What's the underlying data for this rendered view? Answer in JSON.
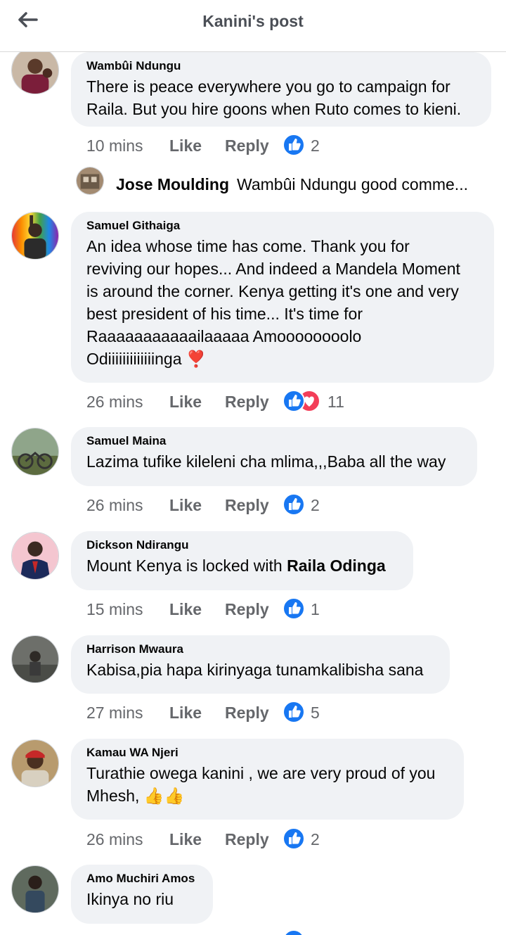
{
  "header": {
    "title": "Kanini's post"
  },
  "colors": {
    "like_blue": "#1877f2",
    "love_red": "#f33e58",
    "bubble_bg": "#f0f2f5",
    "meta_gray": "#65676b"
  },
  "labels": {
    "like": "Like",
    "reply": "Reply"
  },
  "comments": [
    {
      "author": "Wambûi Ndungu",
      "lines": [
        "There is peace everywhere you go to campaign for",
        "Raila. But you hire goons when Ruto comes to kieni."
      ],
      "time": "10 mins",
      "reactions": [
        "like-icon"
      ],
      "count": "2"
    },
    {
      "author": "Samuel Githaiga",
      "lines": [
        "An idea whose time has come. Thank you for",
        "reviving our hopes... And indeed a Mandela Moment",
        "is around the corner. Kenya getting it's one and very",
        "best president of his time... It's time for",
        "Raaaaaaaaaaailaaaaa Amoooooooolo",
        "Odiiiiiiiiiiiiinga ❣️"
      ],
      "time": "26 mins",
      "reactions": [
        "like-icon",
        "love-icon"
      ],
      "count": "11"
    },
    {
      "author": "Samuel Maina",
      "lines": [
        "Lazima tufike kileleni cha mlima,,,Baba all the way"
      ],
      "time": "26 mins",
      "reactions": [
        "like-icon"
      ],
      "count": "2"
    },
    {
      "author": "Dickson Ndirangu",
      "text_prefix": "Mount Kenya is locked with ",
      "text_mention": "Raila Odinga",
      "time": "15 mins",
      "reactions": [
        "like-icon"
      ],
      "count": "1"
    },
    {
      "author": "Harrison Mwaura",
      "lines": [
        "Kabisa,pia hapa kirinyaga tunamkalibisha sana"
      ],
      "time": "27 mins",
      "reactions": [
        "like-icon"
      ],
      "count": "5"
    },
    {
      "author": "Kamau WA Njeri",
      "lines": [
        "Turathie owega kanini , we are very proud of you",
        "Mhesh, 👍👍"
      ],
      "time": "26 mins",
      "reactions": [
        "like-icon"
      ],
      "count": "2"
    },
    {
      "author": "Amo Muchiri Amos",
      "lines": [
        "Ikinya no riu"
      ]
    }
  ],
  "nested_reply": {
    "author": "Jose Moulding",
    "text": "Wambûi Ndungu good comme..."
  }
}
